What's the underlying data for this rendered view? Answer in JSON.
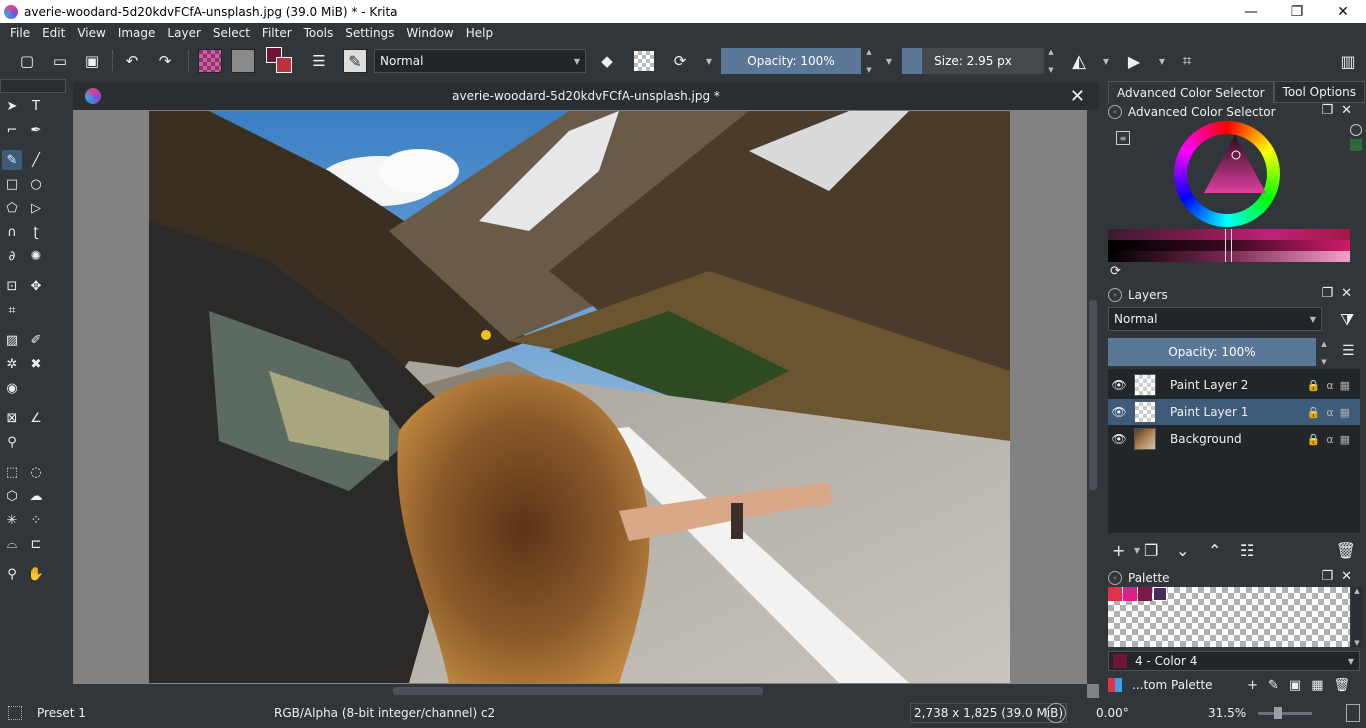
{
  "window": {
    "title": "averie-woodard-5d20kdvFCfA-unsplash.jpg (39.0 MiB)  * - Krita",
    "minimize": "—",
    "restore": "❐",
    "close": "✕"
  },
  "menu": [
    "File",
    "Edit",
    "View",
    "Image",
    "Layer",
    "Select",
    "Filter",
    "Tools",
    "Settings",
    "Window",
    "Help"
  ],
  "toolbar": {
    "blend_mode": "Normal",
    "opacity_label": "Opacity: 100%",
    "size_label": "Size: 2.95 px"
  },
  "colors": {
    "foreground": "#6b1838",
    "background": "#c0303a",
    "accent": "#3e5b7a"
  },
  "document": {
    "tab_title": "averie-woodard-5d20kdvFCfA-unsplash.jpg *",
    "close": "✕"
  },
  "right_panel": {
    "tabs": [
      "Advanced Color Selector",
      "Tool Options"
    ],
    "color_selector_title": "Advanced Color Selector",
    "layers_title": "Layers",
    "layers_blend_mode": "Normal",
    "layers_opacity": "Opacity:  100%",
    "layers": [
      {
        "name": "Paint Layer 2",
        "active": false
      },
      {
        "name": "Paint Layer 1",
        "active": true
      },
      {
        "name": "Background",
        "active": false
      }
    ],
    "palette_title": "Palette",
    "palette_colors": [
      "#e0304c",
      "#e01e8a",
      "#7a1a48",
      "#4a2a5a"
    ],
    "selected_color": "4 - Color 4",
    "palette_name": "...tom Palette"
  },
  "status": {
    "preset": "Preset 1",
    "color_space": "RGB/Alpha (8-bit integer/channel)  c2",
    "image_size": "2,738 x 1,825 (39.0 MiB)",
    "rotation": "0.00°",
    "zoom": "31.5%"
  }
}
